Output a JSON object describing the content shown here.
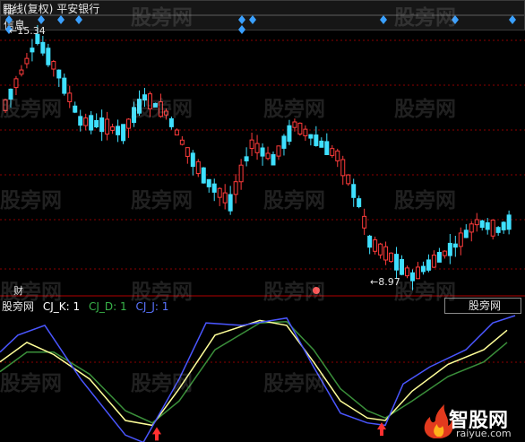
{
  "toolbar": {
    "period": "日线(复权)",
    "stock_name": "平安银行",
    "btn_index": "指",
    "btn_info": "信息"
  },
  "price_chart": {
    "high_label": "15.34",
    "low_label": "8.97",
    "cai_label": "财",
    "event_label": "e"
  },
  "indicator": {
    "name": "股旁网",
    "k_label": "CJ_K: 1",
    "d_label": "CJ_D: 1",
    "j_label": "CJ_J: 1",
    "selector_value": "股旁网"
  },
  "watermark": "股旁网",
  "logo": {
    "text": "智股网",
    "sub": "raiyue.com"
  },
  "colors": {
    "up": "#ff3b3b",
    "down": "#3fe0ff",
    "k": "#ffff99",
    "d": "#3a8f3a",
    "j": "#4a56ff",
    "grid": "#8b0000"
  },
  "chart_data": [
    {
      "type": "candlestick",
      "title": "",
      "y_marks": [
        15.34,
        8.97
      ],
      "x_count": 95
    },
    {
      "type": "line",
      "series": [
        {
          "name": "CJ_K",
          "color": "#ffff99"
        },
        {
          "name": "CJ_D",
          "color": "#3a8f3a"
        },
        {
          "name": "CJ_J",
          "color": "#4a56ff"
        }
      ]
    }
  ]
}
